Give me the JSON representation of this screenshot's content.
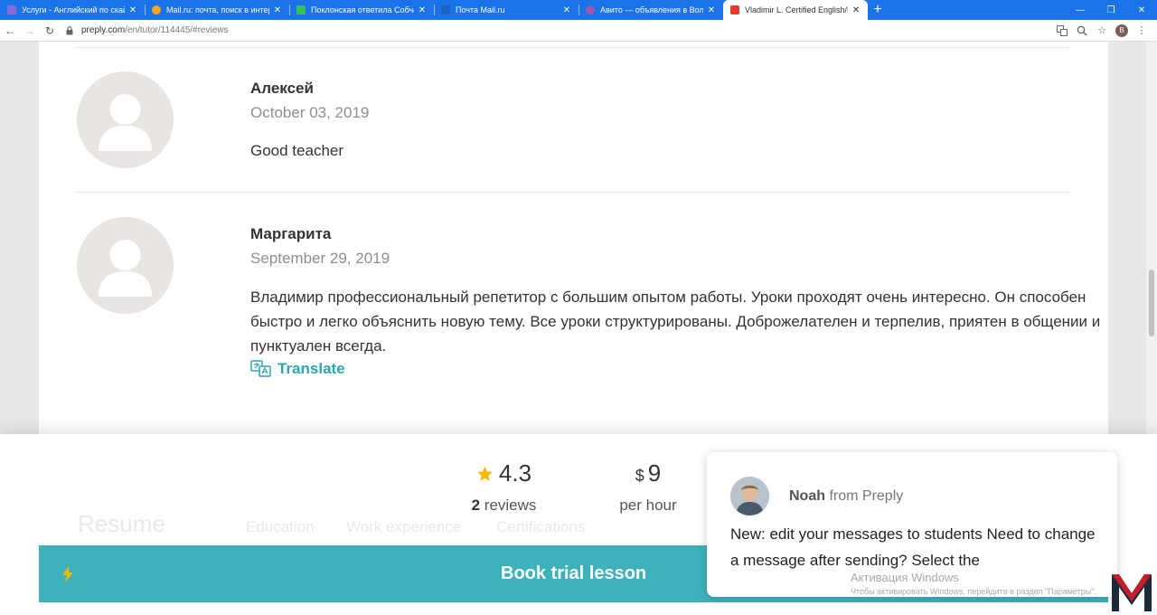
{
  "browser": {
    "tabs": [
      {
        "title": "Услуги - Английский по скайпу",
        "favicon_color": "#8a6ad8",
        "active": false
      },
      {
        "title": "Mail.ru: почта, поиск в интерне",
        "favicon_color": "#f5a623",
        "active": false
      },
      {
        "title": "Поклонская ответила Собчак, с",
        "favicon_color": "#37c159",
        "active": false
      },
      {
        "title": "Почта Mail.ru",
        "favicon_color": "#1565c0",
        "active": false
      },
      {
        "title": "Авито — объявления в Вологде",
        "favicon_color": "#9b59b6",
        "active": false
      },
      {
        "title": "Vladimir L. Certified English/Rus",
        "favicon_color": "#e53935",
        "active": true
      }
    ],
    "url": {
      "domain": "preply.com",
      "path": "/en/tutor/114445/#reviews"
    },
    "avatar_letter": "B"
  },
  "reviews": [
    {
      "name": "Алексей",
      "date": "October 03, 2019",
      "text": "Good teacher"
    },
    {
      "name": "Маргарита",
      "date": "September 29, 2019",
      "text": "Владимир профессиональный репетитор с большим опытом работы. Уроки проходят очень интересно. Он способен быстро и легко объяснить новую тему. Все уроки структурированы. Доброжелателен и терпелив, приятен в общении и пунктуален всегда.",
      "translate_label": "Translate"
    }
  ],
  "stats": {
    "rating": "4.3",
    "reviews_count": "2",
    "reviews_label": "reviews",
    "price_currency": "$",
    "price": "9",
    "price_label": "per hour"
  },
  "faded_section": {
    "heading": "Resume",
    "tabs": [
      "Education",
      "Work experience",
      "Certifications"
    ]
  },
  "book_button": {
    "label": "Book trial lesson"
  },
  "chat": {
    "sender": "Noah",
    "from_label": "from Preply",
    "message": "New: edit your messages to students Need to change a message after sending?  Select the"
  },
  "watermark": {
    "line1": "Активация Windows",
    "line2": "Чтобы активировать Windows, перейдите в раздел \"Параметры\"."
  },
  "colors": {
    "accent": "#3db2bb",
    "star": "#f5b800",
    "link": "#2aa6b4"
  }
}
